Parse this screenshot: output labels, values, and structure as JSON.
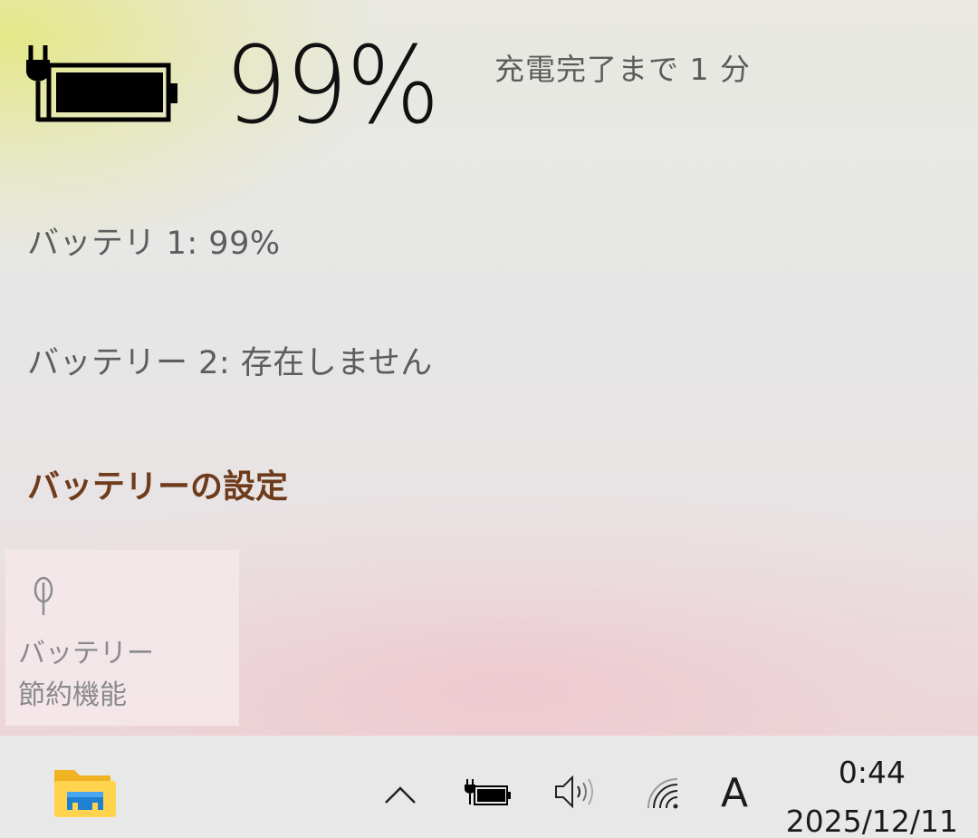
{
  "flyout": {
    "percent": "99%",
    "charge_status": "充電完了まで 1 分",
    "battery1": "バッテリ 1: 99%",
    "battery2": "バッテリー 2: 存在しません",
    "settings_link": "バッテリーの設定",
    "saver_tile": {
      "icon": "leaf-icon",
      "label_line1": "バッテリー",
      "label_line2": "節約機能"
    },
    "battery_icon": "battery-charging-icon",
    "colors": {
      "link": "#6e3b1b",
      "text": "#5d5d5d"
    }
  },
  "taskbar": {
    "icons": [
      "file-explorer-icon",
      "chevron-up-icon",
      "battery-charging-icon",
      "volume-icon",
      "wifi-icon"
    ],
    "ime_mode": "A",
    "time": "0:44",
    "date": "2025/12/11"
  }
}
